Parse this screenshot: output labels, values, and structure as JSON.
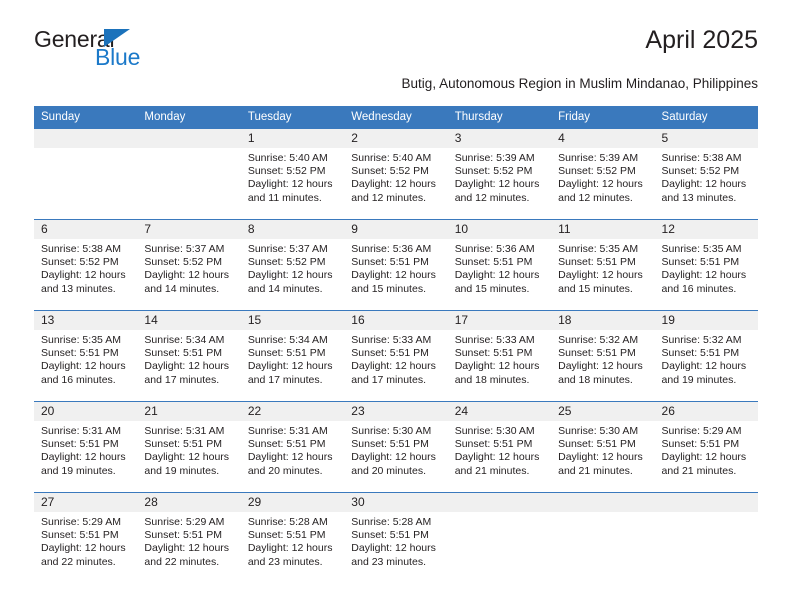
{
  "brand": {
    "name_dark": "General",
    "name_blue": "Blue",
    "accent_color": "#1b72bb",
    "header_color": "#3a79bd",
    "daynum_bg": "#f0f0f0"
  },
  "header": {
    "title": "April 2025",
    "subtitle": "Butig, Autonomous Region in Muslim Mindanao, Philippines"
  },
  "calendar": {
    "weekday_headers": [
      "Sunday",
      "Monday",
      "Tuesday",
      "Wednesday",
      "Thursday",
      "Friday",
      "Saturday"
    ],
    "weeks": [
      [
        {
          "day": "",
          "sunrise": "",
          "sunset": "",
          "daylight1": "",
          "daylight2": ""
        },
        {
          "day": "",
          "sunrise": "",
          "sunset": "",
          "daylight1": "",
          "daylight2": ""
        },
        {
          "day": "1",
          "sunrise": "Sunrise: 5:40 AM",
          "sunset": "Sunset: 5:52 PM",
          "daylight1": "Daylight: 12 hours",
          "daylight2": "and 11 minutes."
        },
        {
          "day": "2",
          "sunrise": "Sunrise: 5:40 AM",
          "sunset": "Sunset: 5:52 PM",
          "daylight1": "Daylight: 12 hours",
          "daylight2": "and 12 minutes."
        },
        {
          "day": "3",
          "sunrise": "Sunrise: 5:39 AM",
          "sunset": "Sunset: 5:52 PM",
          "daylight1": "Daylight: 12 hours",
          "daylight2": "and 12 minutes."
        },
        {
          "day": "4",
          "sunrise": "Sunrise: 5:39 AM",
          "sunset": "Sunset: 5:52 PM",
          "daylight1": "Daylight: 12 hours",
          "daylight2": "and 12 minutes."
        },
        {
          "day": "5",
          "sunrise": "Sunrise: 5:38 AM",
          "sunset": "Sunset: 5:52 PM",
          "daylight1": "Daylight: 12 hours",
          "daylight2": "and 13 minutes."
        }
      ],
      [
        {
          "day": "6",
          "sunrise": "Sunrise: 5:38 AM",
          "sunset": "Sunset: 5:52 PM",
          "daylight1": "Daylight: 12 hours",
          "daylight2": "and 13 minutes."
        },
        {
          "day": "7",
          "sunrise": "Sunrise: 5:37 AM",
          "sunset": "Sunset: 5:52 PM",
          "daylight1": "Daylight: 12 hours",
          "daylight2": "and 14 minutes."
        },
        {
          "day": "8",
          "sunrise": "Sunrise: 5:37 AM",
          "sunset": "Sunset: 5:52 PM",
          "daylight1": "Daylight: 12 hours",
          "daylight2": "and 14 minutes."
        },
        {
          "day": "9",
          "sunrise": "Sunrise: 5:36 AM",
          "sunset": "Sunset: 5:51 PM",
          "daylight1": "Daylight: 12 hours",
          "daylight2": "and 15 minutes."
        },
        {
          "day": "10",
          "sunrise": "Sunrise: 5:36 AM",
          "sunset": "Sunset: 5:51 PM",
          "daylight1": "Daylight: 12 hours",
          "daylight2": "and 15 minutes."
        },
        {
          "day": "11",
          "sunrise": "Sunrise: 5:35 AM",
          "sunset": "Sunset: 5:51 PM",
          "daylight1": "Daylight: 12 hours",
          "daylight2": "and 15 minutes."
        },
        {
          "day": "12",
          "sunrise": "Sunrise: 5:35 AM",
          "sunset": "Sunset: 5:51 PM",
          "daylight1": "Daylight: 12 hours",
          "daylight2": "and 16 minutes."
        }
      ],
      [
        {
          "day": "13",
          "sunrise": "Sunrise: 5:35 AM",
          "sunset": "Sunset: 5:51 PM",
          "daylight1": "Daylight: 12 hours",
          "daylight2": "and 16 minutes."
        },
        {
          "day": "14",
          "sunrise": "Sunrise: 5:34 AM",
          "sunset": "Sunset: 5:51 PM",
          "daylight1": "Daylight: 12 hours",
          "daylight2": "and 17 minutes."
        },
        {
          "day": "15",
          "sunrise": "Sunrise: 5:34 AM",
          "sunset": "Sunset: 5:51 PM",
          "daylight1": "Daylight: 12 hours",
          "daylight2": "and 17 minutes."
        },
        {
          "day": "16",
          "sunrise": "Sunrise: 5:33 AM",
          "sunset": "Sunset: 5:51 PM",
          "daylight1": "Daylight: 12 hours",
          "daylight2": "and 17 minutes."
        },
        {
          "day": "17",
          "sunrise": "Sunrise: 5:33 AM",
          "sunset": "Sunset: 5:51 PM",
          "daylight1": "Daylight: 12 hours",
          "daylight2": "and 18 minutes."
        },
        {
          "day": "18",
          "sunrise": "Sunrise: 5:32 AM",
          "sunset": "Sunset: 5:51 PM",
          "daylight1": "Daylight: 12 hours",
          "daylight2": "and 18 minutes."
        },
        {
          "day": "19",
          "sunrise": "Sunrise: 5:32 AM",
          "sunset": "Sunset: 5:51 PM",
          "daylight1": "Daylight: 12 hours",
          "daylight2": "and 19 minutes."
        }
      ],
      [
        {
          "day": "20",
          "sunrise": "Sunrise: 5:31 AM",
          "sunset": "Sunset: 5:51 PM",
          "daylight1": "Daylight: 12 hours",
          "daylight2": "and 19 minutes."
        },
        {
          "day": "21",
          "sunrise": "Sunrise: 5:31 AM",
          "sunset": "Sunset: 5:51 PM",
          "daylight1": "Daylight: 12 hours",
          "daylight2": "and 19 minutes."
        },
        {
          "day": "22",
          "sunrise": "Sunrise: 5:31 AM",
          "sunset": "Sunset: 5:51 PM",
          "daylight1": "Daylight: 12 hours",
          "daylight2": "and 20 minutes."
        },
        {
          "day": "23",
          "sunrise": "Sunrise: 5:30 AM",
          "sunset": "Sunset: 5:51 PM",
          "daylight1": "Daylight: 12 hours",
          "daylight2": "and 20 minutes."
        },
        {
          "day": "24",
          "sunrise": "Sunrise: 5:30 AM",
          "sunset": "Sunset: 5:51 PM",
          "daylight1": "Daylight: 12 hours",
          "daylight2": "and 21 minutes."
        },
        {
          "day": "25",
          "sunrise": "Sunrise: 5:30 AM",
          "sunset": "Sunset: 5:51 PM",
          "daylight1": "Daylight: 12 hours",
          "daylight2": "and 21 minutes."
        },
        {
          "day": "26",
          "sunrise": "Sunrise: 5:29 AM",
          "sunset": "Sunset: 5:51 PM",
          "daylight1": "Daylight: 12 hours",
          "daylight2": "and 21 minutes."
        }
      ],
      [
        {
          "day": "27",
          "sunrise": "Sunrise: 5:29 AM",
          "sunset": "Sunset: 5:51 PM",
          "daylight1": "Daylight: 12 hours",
          "daylight2": "and 22 minutes."
        },
        {
          "day": "28",
          "sunrise": "Sunrise: 5:29 AM",
          "sunset": "Sunset: 5:51 PM",
          "daylight1": "Daylight: 12 hours",
          "daylight2": "and 22 minutes."
        },
        {
          "day": "29",
          "sunrise": "Sunrise: 5:28 AM",
          "sunset": "Sunset: 5:51 PM",
          "daylight1": "Daylight: 12 hours",
          "daylight2": "and 23 minutes."
        },
        {
          "day": "30",
          "sunrise": "Sunrise: 5:28 AM",
          "sunset": "Sunset: 5:51 PM",
          "daylight1": "Daylight: 12 hours",
          "daylight2": "and 23 minutes."
        },
        {
          "day": "",
          "sunrise": "",
          "sunset": "",
          "daylight1": "",
          "daylight2": ""
        },
        {
          "day": "",
          "sunrise": "",
          "sunset": "",
          "daylight1": "",
          "daylight2": ""
        },
        {
          "day": "",
          "sunrise": "",
          "sunset": "",
          "daylight1": "",
          "daylight2": ""
        }
      ]
    ]
  }
}
